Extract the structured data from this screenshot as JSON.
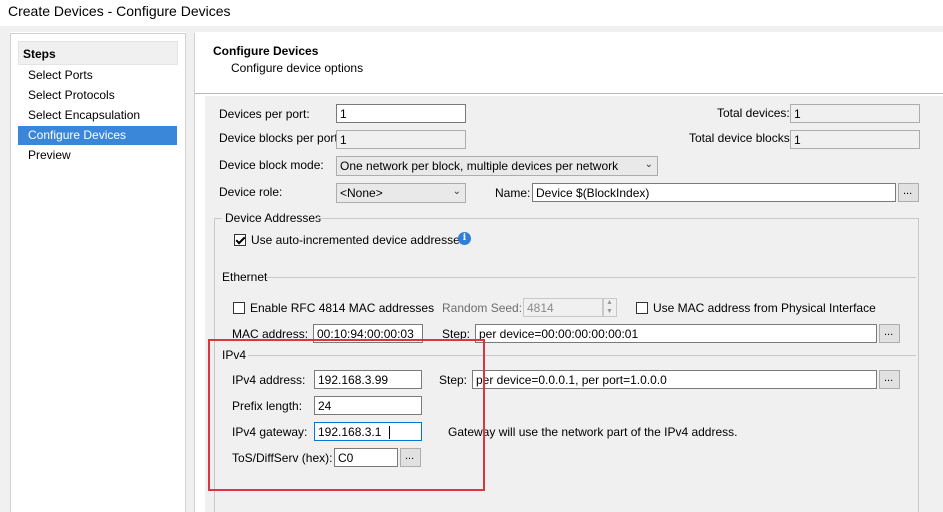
{
  "window": {
    "title": "Create Devices - Configure Devices"
  },
  "steps": {
    "header": "Steps",
    "items": [
      {
        "label": "Select Ports"
      },
      {
        "label": "Select Protocols"
      },
      {
        "label": "Select Encapsulation"
      },
      {
        "label": "Configure Devices"
      },
      {
        "label": "Preview"
      }
    ],
    "selected": "Configure Devices"
  },
  "page": {
    "title": "Configure Devices",
    "subtitle": "Configure device options"
  },
  "general": {
    "devices_per_port_label": "Devices per port:",
    "devices_per_port": "1",
    "total_devices_label": "Total devices:",
    "total_devices": "1",
    "device_blocks_per_port_label": "Device blocks per port:",
    "device_blocks_per_port": "1",
    "total_device_blocks_label": "Total device blocks:",
    "total_device_blocks": "1",
    "device_block_mode_label": "Device block mode:",
    "device_block_mode": "One network per block, multiple devices per network",
    "device_role_label": "Device role:",
    "device_role": "<None>",
    "name_label": "Name:",
    "name_value": "Device $(BlockIndex)",
    "ellipsis": "..."
  },
  "device_addresses": {
    "label": "Device Addresses",
    "auto_increment_label": "Use auto-incremented device addresses",
    "auto_increment_checked": true
  },
  "ethernet": {
    "label": "Ethernet",
    "rfc4814_label": "Enable RFC 4814 MAC addresses",
    "rfc4814_checked": false,
    "random_seed_label": "Random Seed:",
    "random_seed": "4814",
    "use_phys_mac_label": "Use MAC address from Physical Interface",
    "use_phys_mac_checked": false,
    "mac_label": "MAC address:",
    "mac_value": "00:10:94:00:00:03",
    "step_label": "Step:",
    "step_value": "per device=00:00:00:00:00:01"
  },
  "ipv4": {
    "label": "IPv4",
    "address_label": "IPv4 address:",
    "address_value": "192.168.3.99",
    "step_label": "Step:",
    "step_value": "per device=0.0.0.1, per port=1.0.0.0",
    "prefix_label": "Prefix length:",
    "prefix_value": "24",
    "gateway_label": "IPv4 gateway:",
    "gateway_value": "192.168.3.1",
    "gateway_note": "Gateway will use the network part of the IPv4 address.",
    "tos_label": "ToS/DiffServ (hex):",
    "tos_value": "C0"
  },
  "colors": {
    "selection": "#3a87d9",
    "highlight_box": "#d9363e",
    "info_icon": "#2f7fd8"
  }
}
